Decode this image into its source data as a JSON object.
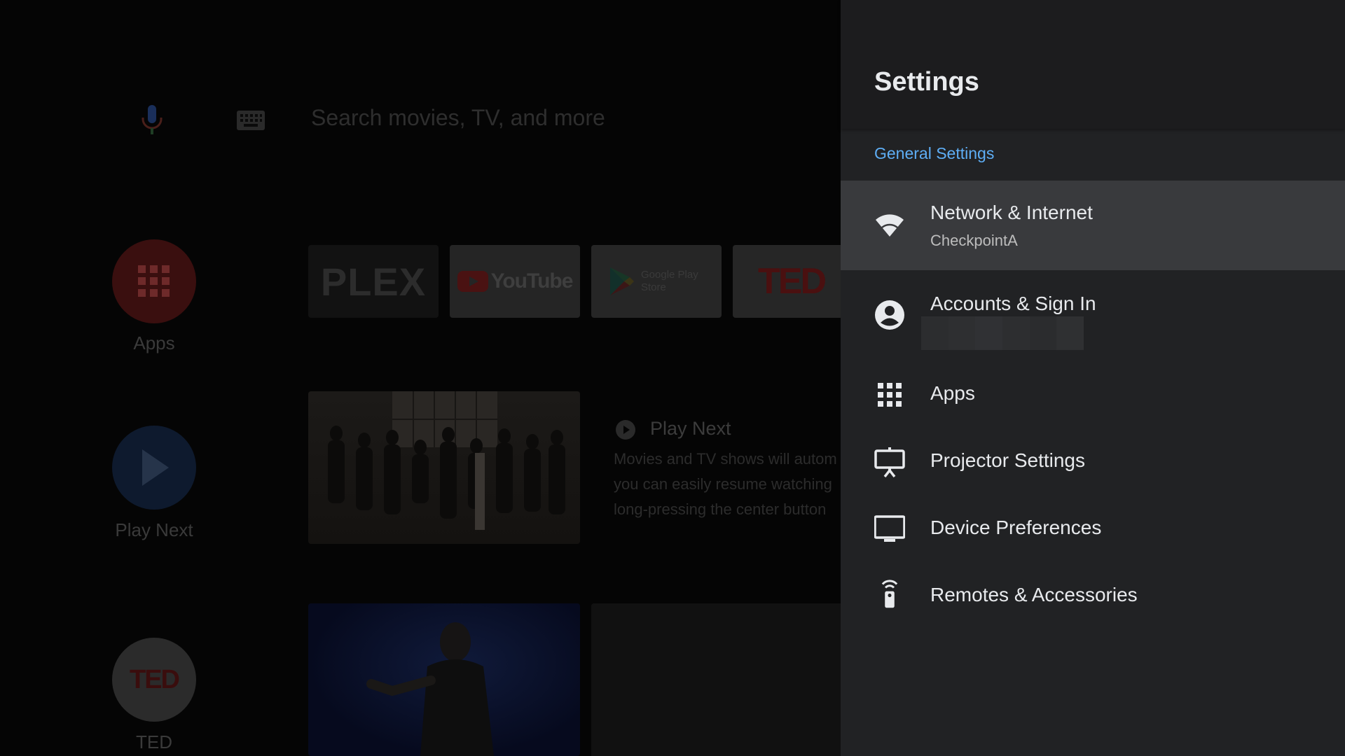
{
  "home": {
    "search": {
      "placeholder": "Search movies, TV, and more"
    },
    "side_nav": [
      {
        "label": "Apps",
        "icon": "apps-grid-icon"
      },
      {
        "label": "Play Next",
        "icon": "play-icon"
      },
      {
        "label": "TED",
        "icon": "ted-logo"
      }
    ],
    "favorite_apps": [
      {
        "name": "PLEX"
      },
      {
        "name": "YouTube"
      },
      {
        "name": "Google Play Store"
      },
      {
        "name": "TED"
      }
    ],
    "play_next": {
      "title": "Play Next",
      "description_lines": [
        "Movies and TV shows will autom",
        "you can easily resume watching",
        "long-pressing the center button"
      ]
    }
  },
  "settings": {
    "title": "Settings",
    "section": "General Settings",
    "items": [
      {
        "label": "Network & Internet",
        "sublabel": "CheckpointA",
        "icon": "wifi-icon",
        "focused": true
      },
      {
        "label": "Accounts & Sign In",
        "sublabel": "",
        "icon": "account-circle-icon",
        "focused": false
      },
      {
        "label": "Apps",
        "sublabel": "",
        "icon": "apps-grid-icon",
        "focused": false
      },
      {
        "label": "Projector Settings",
        "sublabel": "",
        "icon": "projector-icon",
        "focused": false
      },
      {
        "label": "Device Preferences",
        "sublabel": "",
        "icon": "monitor-icon",
        "focused": false
      },
      {
        "label": "Remotes & Accessories",
        "sublabel": "",
        "icon": "remote-icon",
        "focused": false
      }
    ]
  },
  "colors": {
    "panel_bg": "#212224",
    "focused_bg": "#393a3d",
    "accent": "#5eaef5",
    "text": "#e8eaed"
  }
}
